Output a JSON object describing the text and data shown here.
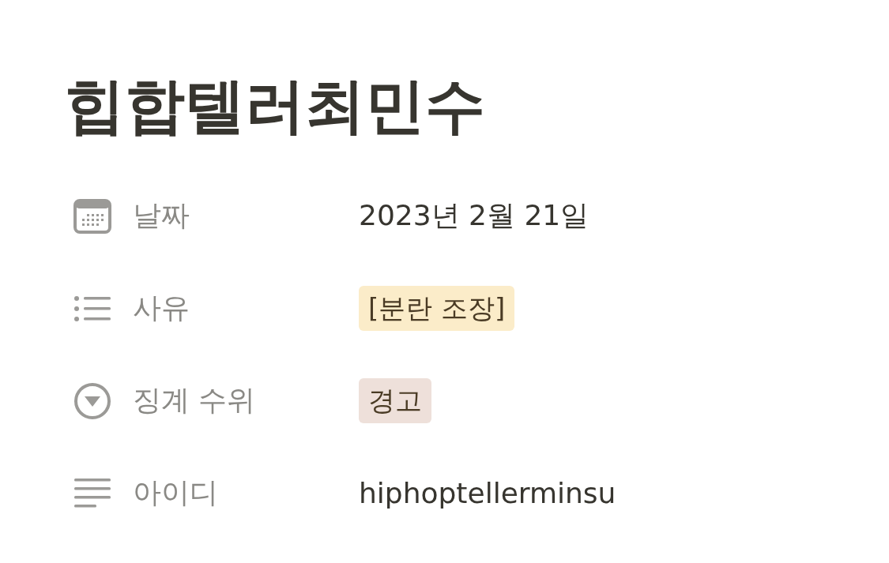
{
  "page": {
    "title": "힙합텔러최민수"
  },
  "properties": [
    {
      "kind": "date",
      "label": "날짜",
      "value": "2023년 2월 21일"
    },
    {
      "kind": "multi_select",
      "label": "사유",
      "tags": [
        {
          "text": "[분란 조장]",
          "color": "#fbecc9"
        }
      ]
    },
    {
      "kind": "select",
      "label": "징계 수위",
      "tags": [
        {
          "text": "경고",
          "color": "#eee0da"
        }
      ]
    },
    {
      "kind": "text",
      "label": "아이디",
      "value": "hiphoptellerminsu"
    }
  ]
}
